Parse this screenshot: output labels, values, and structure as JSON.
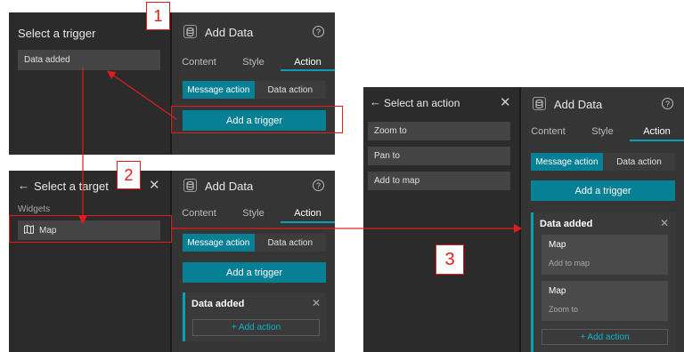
{
  "panel1": {
    "trigger_title": "Select a trigger",
    "trigger_item": "Data added",
    "widget_title": "Add Data",
    "tabs": [
      "Content",
      "Style",
      "Action"
    ],
    "message_action": "Message action",
    "data_action": "Data action",
    "add_trigger": "Add a trigger"
  },
  "panel2": {
    "target_title": "Select a target",
    "widgets_label": "Widgets",
    "map_item": "Map",
    "widget_title": "Add Data",
    "tabs": [
      "Content",
      "Style",
      "Action"
    ],
    "message_action": "Message action",
    "data_action": "Data action",
    "add_trigger": "Add a trigger",
    "card_title": "Data added",
    "add_action": "+ Add action"
  },
  "panel3": {
    "action_title": "Select an action",
    "actions": [
      "Zoom to",
      "Pan to",
      "Add to map"
    ],
    "widget_title": "Add Data",
    "tabs": [
      "Content",
      "Style",
      "Action"
    ],
    "message_action": "Message action",
    "data_action": "Data action",
    "add_trigger": "Add a trigger",
    "card_title": "Data added",
    "sub_actions": [
      {
        "title": "Map",
        "desc": "Add to map"
      },
      {
        "title": "Map",
        "desc": "Zoom to"
      }
    ],
    "add_action": "+ Add action"
  },
  "annotations": {
    "step1": "1",
    "step2": "2",
    "step3": "3",
    "accent_color": "#e01c1c"
  }
}
